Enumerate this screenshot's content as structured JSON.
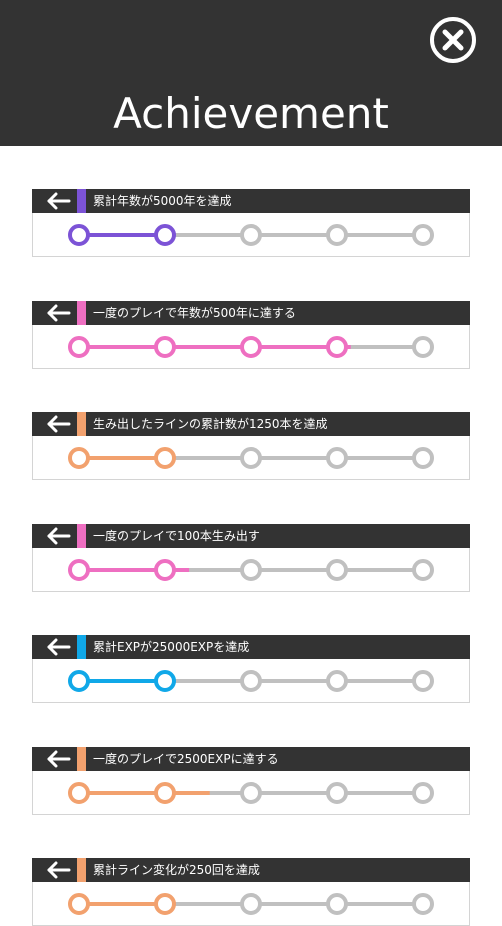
{
  "header": {
    "title": "Achievement",
    "close_icon": "close-circle-icon",
    "background": "#333333"
  },
  "colors": {
    "inactive": "#c0c0c0",
    "header_bg": "#333333"
  },
  "achievements": [
    {
      "label": "累計年数が5000年を達成",
      "color": "#7c53d6",
      "reached_nodes": 2,
      "progress": 0.28
    },
    {
      "label": "一度のプレイで年数が500年に達する",
      "color": "#ee6fc1",
      "reached_nodes": 4,
      "progress": 0.79
    },
    {
      "label": "生み出したラインの累計数が1250本を達成",
      "color": "#f2a16e",
      "reached_nodes": 2,
      "progress": 0.25
    },
    {
      "label": "一度のプレイで100本生み出す",
      "color": "#ee6fc1",
      "reached_nodes": 2,
      "progress": 0.32
    },
    {
      "label": "累計EXPが25000EXPを達成",
      "color": "#10a8e8",
      "reached_nodes": 2,
      "progress": 0.25
    },
    {
      "label": "一度のプレイで2500EXPに達する",
      "color": "#f2a16e",
      "reached_nodes": 2,
      "progress": 0.38
    },
    {
      "label": "累計ライン変化が250回を達成",
      "color": "#f2a16e",
      "reached_nodes": 2,
      "progress": 0.25
    }
  ]
}
